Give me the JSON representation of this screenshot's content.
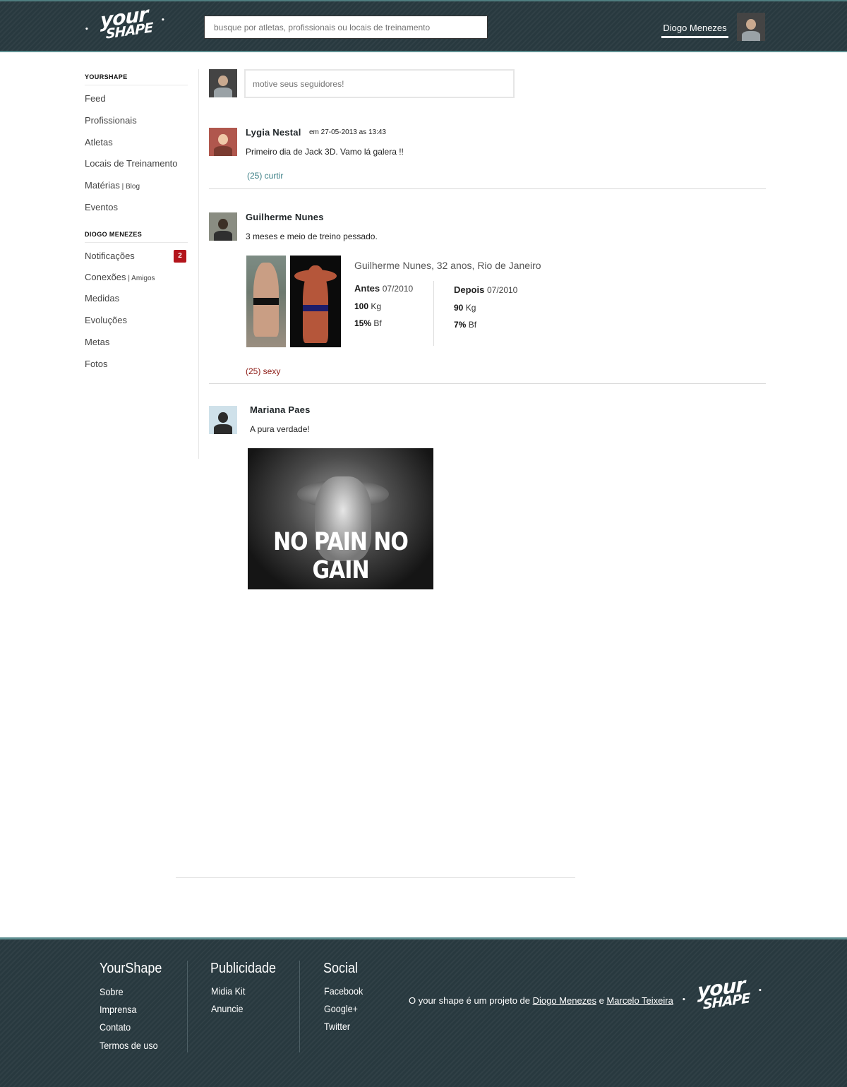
{
  "header": {
    "logo_top": "your",
    "logo_bottom": "SHAPE",
    "search_placeholder": "busque por atletas, profissionais ou locais de treinamento",
    "user_name": "Diogo Menezes"
  },
  "sidebar": {
    "section1_title": "YOURSHAPE",
    "section1_items": [
      {
        "label": "Feed"
      },
      {
        "label": "Profissionais"
      },
      {
        "label": "Atletas"
      },
      {
        "label": "Locais de Treinamento"
      },
      {
        "label": "Matérias",
        "sep": " | ",
        "sub": "Blog"
      },
      {
        "label": "Eventos"
      }
    ],
    "section2_title": "DIOGO MENEZES",
    "section2_items": [
      {
        "label": "Notificações",
        "badge": "2"
      },
      {
        "label": "Conexões",
        "sep": " | ",
        "sub": "Amigos"
      },
      {
        "label": "Medidas"
      },
      {
        "label": "Evoluções"
      },
      {
        "label": "Metas"
      },
      {
        "label": "Fotos"
      }
    ],
    "badge_color": "#b3141b"
  },
  "feed": {
    "compose_placeholder": "motive seus seguidores!",
    "posts": [
      {
        "author": "Lygia Nestal",
        "date": "em 27-05-2013 as 13:43",
        "text": "Primeiro dia de Jack 3D. Vamo lá galera !!",
        "like": "(25) curtir"
      },
      {
        "author": "Guilherme Nunes",
        "text": "3 meses e meio de treino pessado.",
        "comparison": {
          "title": "Guilherme Nunes, 32 anos, Rio de Janeiro",
          "before_label": "Antes",
          "before_date": "07/2010",
          "before_weight": "100",
          "before_bf": "15%",
          "after_label": "Depois",
          "after_date": "07/2010",
          "after_weight": "90",
          "after_bf": "7%",
          "weight_unit": "Kg",
          "bf_unit": "Bf"
        },
        "like": "(25) sexy"
      },
      {
        "author": "Mariana Paes",
        "text": "A pura verdade!",
        "image_caption": "NO PAIN NO GAIN"
      }
    ]
  },
  "footer": {
    "col1_title": "YourShape",
    "col1_links": [
      "Sobre",
      "Imprensa",
      "Contato",
      "Termos de uso"
    ],
    "col2_title": "Publicidade",
    "col2_links": [
      "Midia Kit",
      "Anuncie"
    ],
    "col3_title": "Social",
    "col3_links": [
      "Facebook",
      "Google+",
      "Twitter"
    ],
    "credit_prefix": "O your shape é um projeto de",
    "credit_author1": "Diogo Menezes",
    "credit_and": "e",
    "credit_author2": "Marcelo Teixeira"
  },
  "colors": {
    "header_bg": "#28393f",
    "accent_teal": "#5e8f91",
    "like_teal": "#3b7f86",
    "like_red": "#8c1a14"
  }
}
